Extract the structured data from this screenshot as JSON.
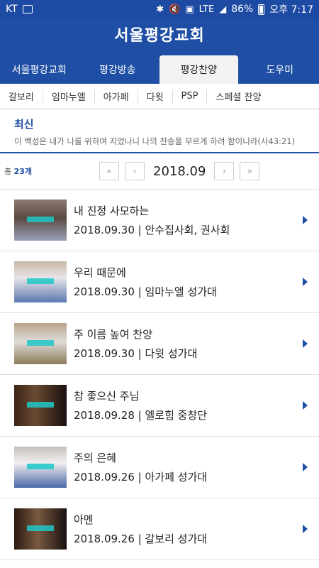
{
  "status": {
    "carrier": "KT",
    "battery": "86%",
    "time": "오후 7:17",
    "network": "LTE"
  },
  "header": {
    "logo": "서울평강교회"
  },
  "main_tabs": [
    {
      "label": "서울평강교회"
    },
    {
      "label": "평강방송"
    },
    {
      "label": "평강찬양",
      "active": true
    },
    {
      "label": "도우미"
    }
  ],
  "sub_tabs": [
    {
      "label": "갈보리"
    },
    {
      "label": "임마누엘"
    },
    {
      "label": "아가페"
    },
    {
      "label": "다윗"
    },
    {
      "label": "PSP"
    },
    {
      "label": "스페셜 찬양"
    }
  ],
  "latest": {
    "title": "최신",
    "verse": "이 백성은 내가 나를 위하여 지었나니 나의 찬송을 부르게 하려 함이니라(사43:21)"
  },
  "pager": {
    "total_prefix": "총",
    "total_count": "23개",
    "first": "«",
    "prev": "‹",
    "date": "2018.09",
    "next": "›",
    "last": "»"
  },
  "items": [
    {
      "title": "내 진정 사모하는",
      "meta": "2018.09.30 | 안수집사회, 권사회"
    },
    {
      "title": "우리 때문에",
      "meta": "2018.09.30 | 임마누엘 성가대"
    },
    {
      "title": "주 이름 높여 찬양",
      "meta": "2018.09.30 | 다윗 성가대"
    },
    {
      "title": "참 좋으신 주님",
      "meta": "2018.09.28 | 엘로힘 중창단"
    },
    {
      "title": "주의 은혜",
      "meta": "2018.09.26 | 아가페 성가대"
    },
    {
      "title": "아멘",
      "meta": "2018.09.26 | 갈보리 성가대"
    }
  ],
  "colors": {
    "brand": "#1f4ea5",
    "thumb_choir": "#6b5a4e",
    "thumb_piano": "#2a1a14"
  }
}
